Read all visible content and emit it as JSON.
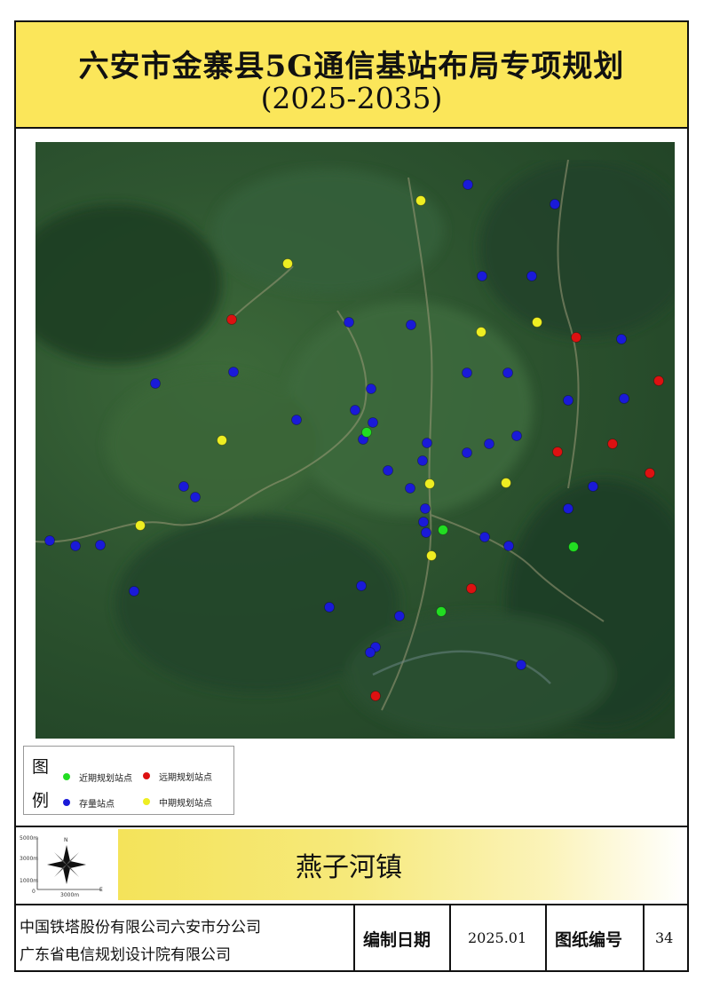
{
  "title": {
    "line1": "六安市金寨县5G通信基站布局专项规划",
    "line2": "(2025-2035)"
  },
  "colors": {
    "near_term": "#22dd22",
    "long_term": "#dd1111",
    "existing": "#1a1ad8",
    "mid_term": "#eeee22",
    "title_bg": "#fbe65a"
  },
  "legend": {
    "title_top": "图",
    "title_bottom": "例",
    "items": [
      {
        "label": "近期规划站点",
        "color": "#22dd22"
      },
      {
        "label": "远期规划站点",
        "color": "#dd1111"
      },
      {
        "label": "存量站点",
        "color": "#1a1ad8"
      },
      {
        "label": "中期规划站点",
        "color": "#eeee22"
      }
    ]
  },
  "scale_bar": {
    "v1": "5000m",
    "v2": "3000m",
    "v3": "1000m",
    "v4": "0",
    "h": "3000m",
    "north": "N",
    "east": "E"
  },
  "town": "燕子河镇",
  "footer": {
    "company1": "中国铁塔股份有限公司六安市分公司",
    "company2": "广东省电信规划设计院有限公司",
    "date_label": "编制日期",
    "date_value": "2025.01",
    "sheet_label": "图纸编号",
    "sheet_value": "34"
  }
}
